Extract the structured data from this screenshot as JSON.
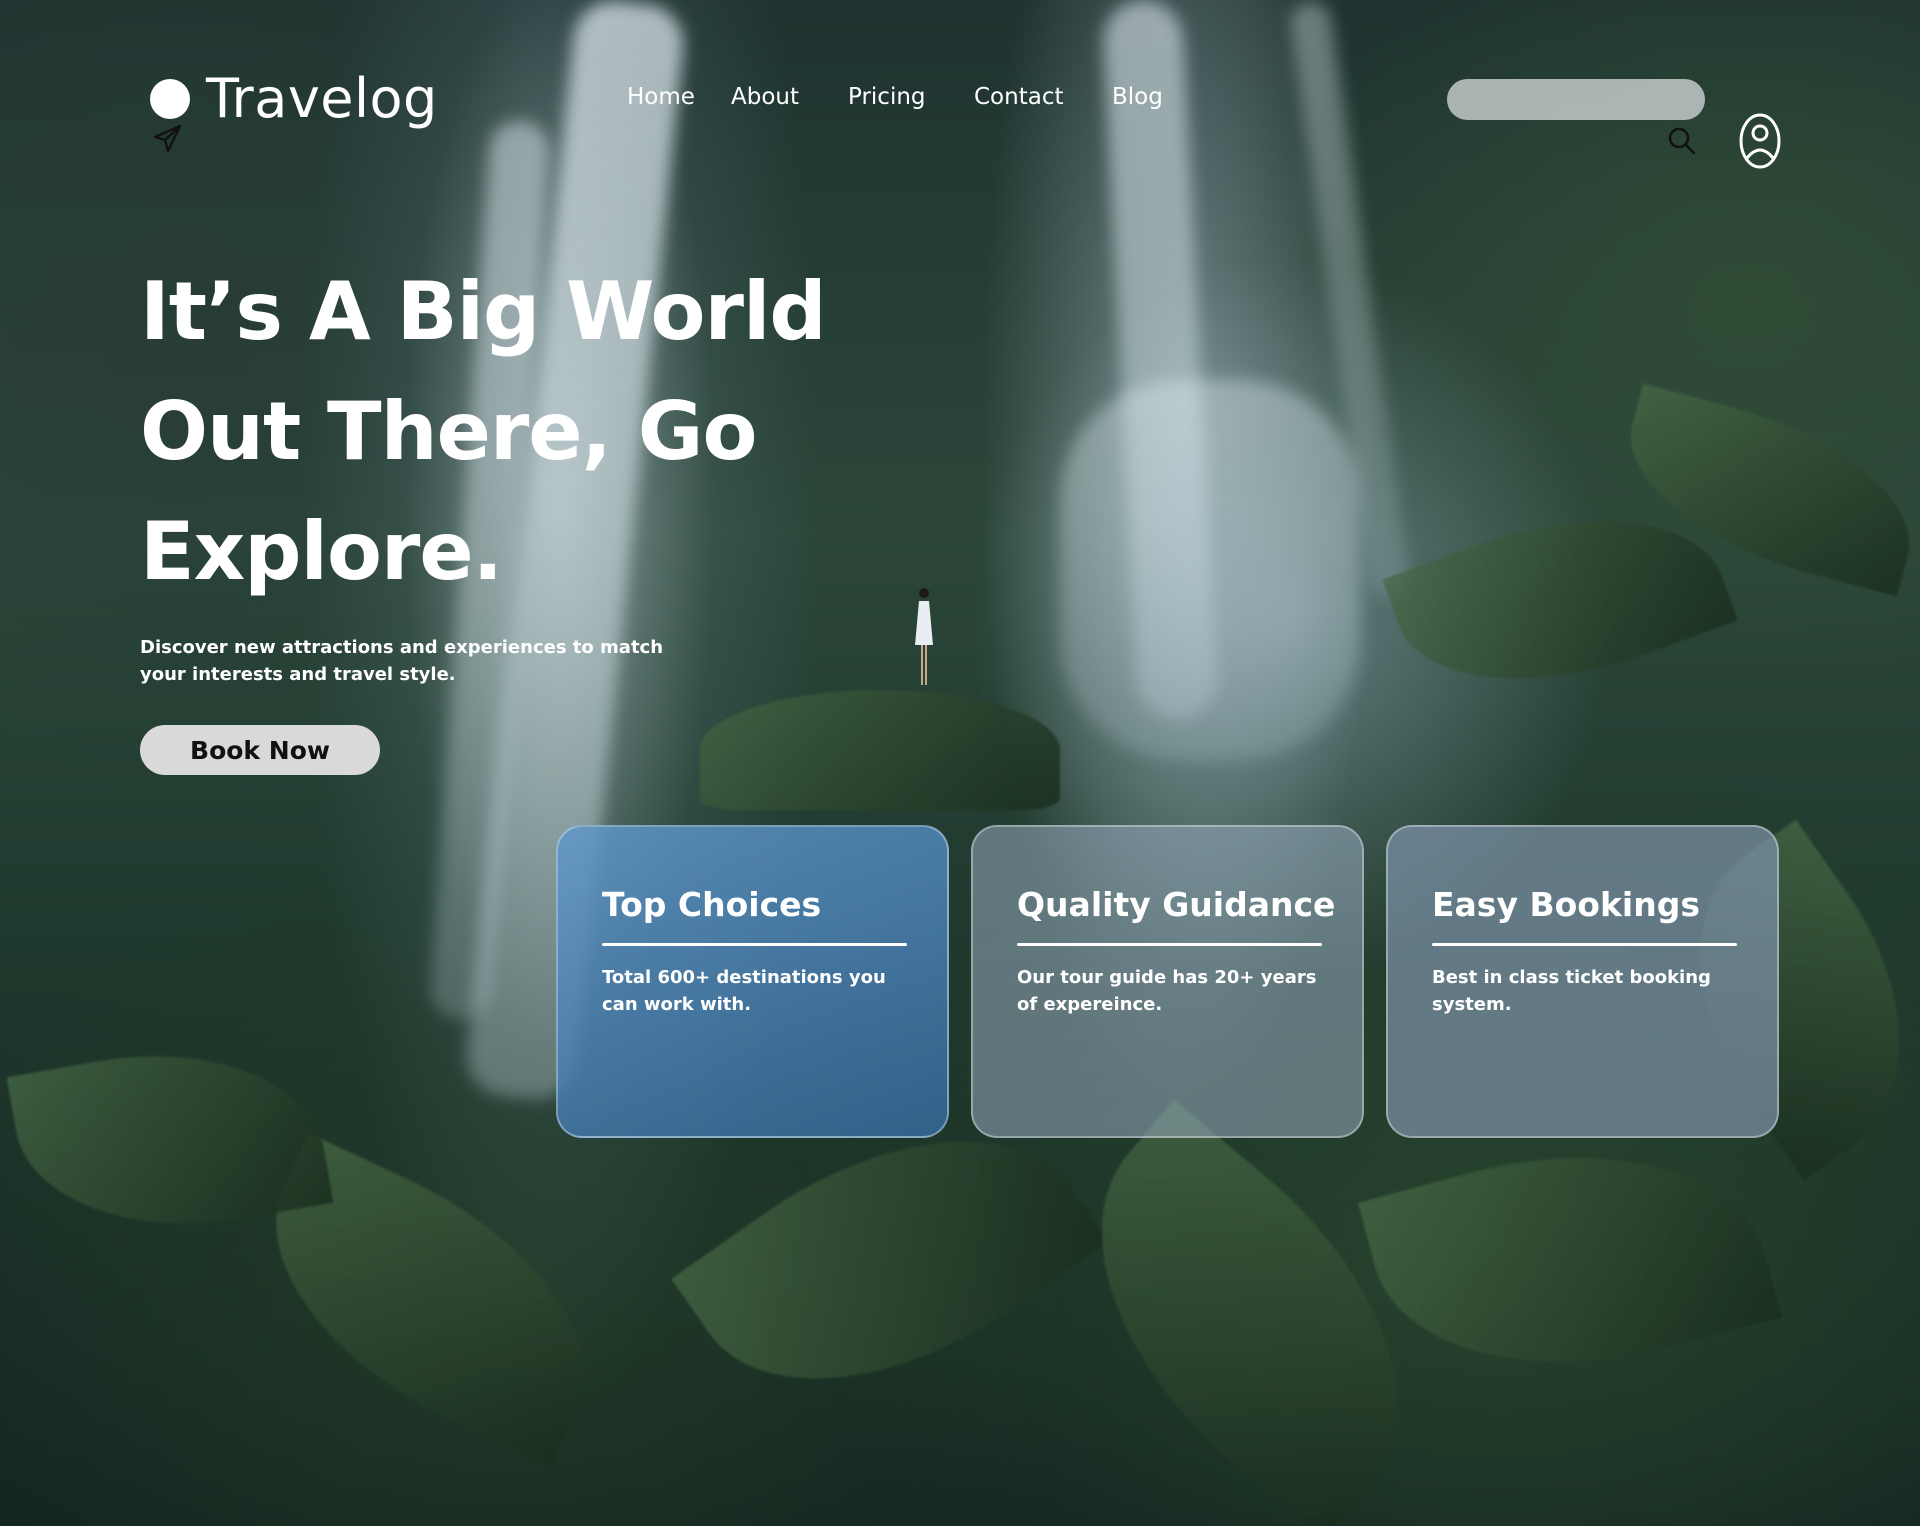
{
  "brand": {
    "name": "Travelog",
    "logo_icon": "circle-logo-icon",
    "plane_icon": "paper-plane-icon"
  },
  "nav": {
    "items": [
      {
        "label": "Home"
      },
      {
        "label": "About"
      },
      {
        "label": "Pricing"
      },
      {
        "label": "Contact"
      },
      {
        "label": "Blog"
      }
    ]
  },
  "search": {
    "value": "",
    "placeholder": "",
    "icon": "search-icon"
  },
  "account": {
    "icon": "user-circle-icon"
  },
  "hero": {
    "title_lines": [
      "It’s A Big World",
      "Out There, Go",
      "Explore."
    ],
    "subtitle": "Discover new attractions and experiences to match your interests and travel style.",
    "cta_label": "Book Now"
  },
  "cards": [
    {
      "title": "Top Choices",
      "text": "Total 600+ destinations you can work with."
    },
    {
      "title": "Quality Guidance",
      "text": "Our tour guide has 20+ years of expereince."
    },
    {
      "title": "Easy Bookings",
      "text": "Best in class ticket booking system."
    }
  ],
  "colors": {
    "text": "#ffffff",
    "button_bg": "#d9d9d9",
    "button_text": "#111111",
    "search_bg": "#d2d6d7",
    "card_primary": "#5f96c8",
    "card_secondary": "#8296af"
  }
}
